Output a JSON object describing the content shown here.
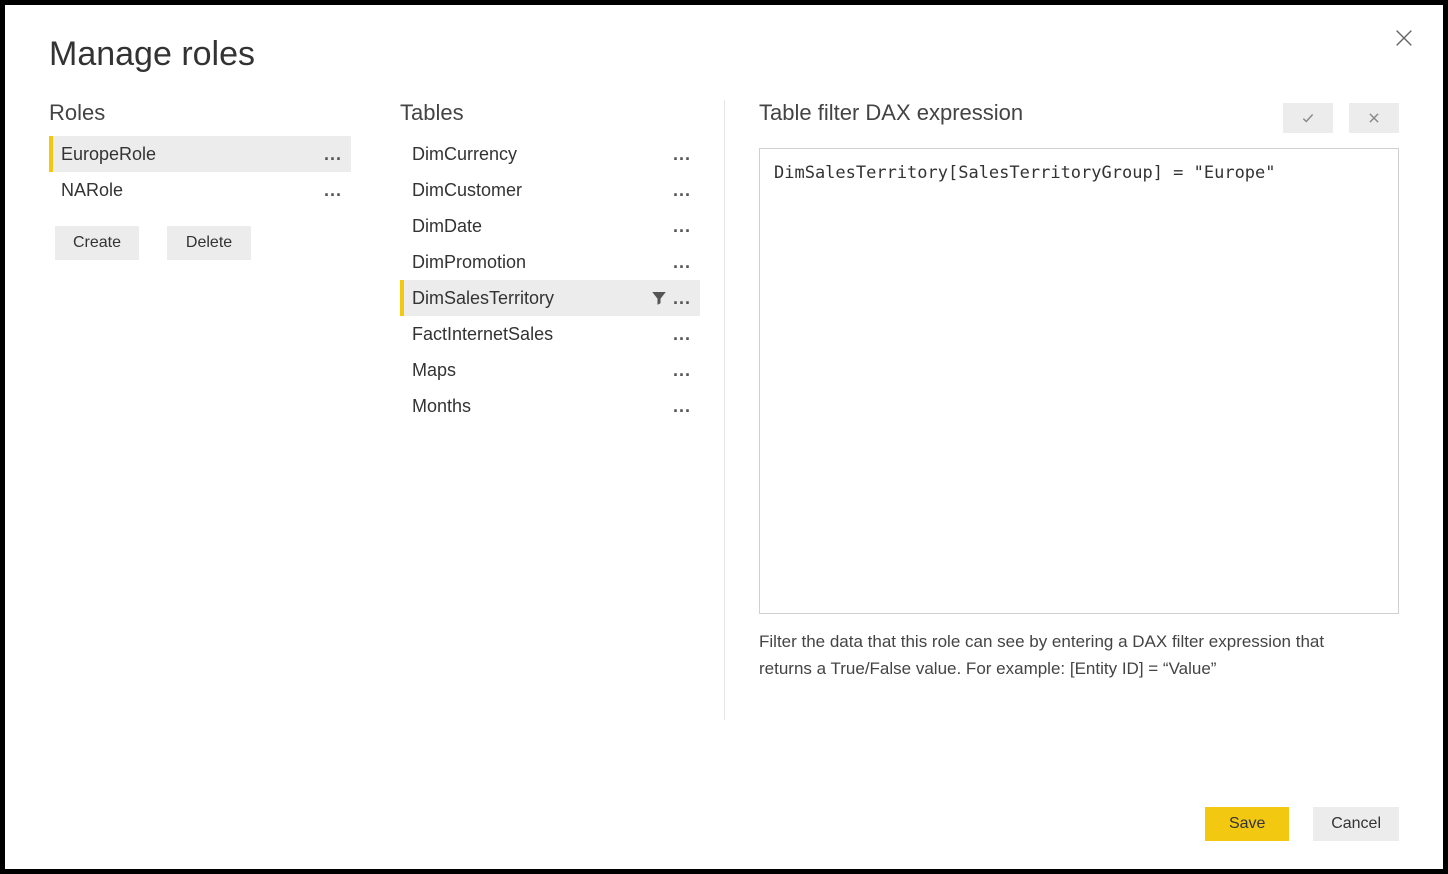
{
  "dialog": {
    "title": "Manage roles",
    "close_icon": "close-icon"
  },
  "roles": {
    "header": "Roles",
    "items": [
      {
        "label": "EuropeRole",
        "selected": true
      },
      {
        "label": "NARole",
        "selected": false
      }
    ],
    "create_label": "Create",
    "delete_label": "Delete"
  },
  "tables": {
    "header": "Tables",
    "items": [
      {
        "label": "DimCurrency",
        "selected": false,
        "has_filter": false
      },
      {
        "label": "DimCustomer",
        "selected": false,
        "has_filter": false
      },
      {
        "label": "DimDate",
        "selected": false,
        "has_filter": false
      },
      {
        "label": "DimPromotion",
        "selected": false,
        "has_filter": false
      },
      {
        "label": "DimSalesTerritory",
        "selected": true,
        "has_filter": true
      },
      {
        "label": "FactInternetSales",
        "selected": false,
        "has_filter": false
      },
      {
        "label": "Maps",
        "selected": false,
        "has_filter": false
      },
      {
        "label": "Months",
        "selected": false,
        "has_filter": false
      }
    ]
  },
  "dax": {
    "header": "Table filter DAX expression",
    "expression": "DimSalesTerritory[SalesTerritoryGroup] = \"Europe\"",
    "hint": "Filter the data that this role can see by entering a DAX filter expression that returns a True/False value. For example: [Entity ID] = “Value”"
  },
  "footer": {
    "save_label": "Save",
    "cancel_label": "Cancel"
  },
  "glyphs": {
    "ellipsis": "..."
  }
}
